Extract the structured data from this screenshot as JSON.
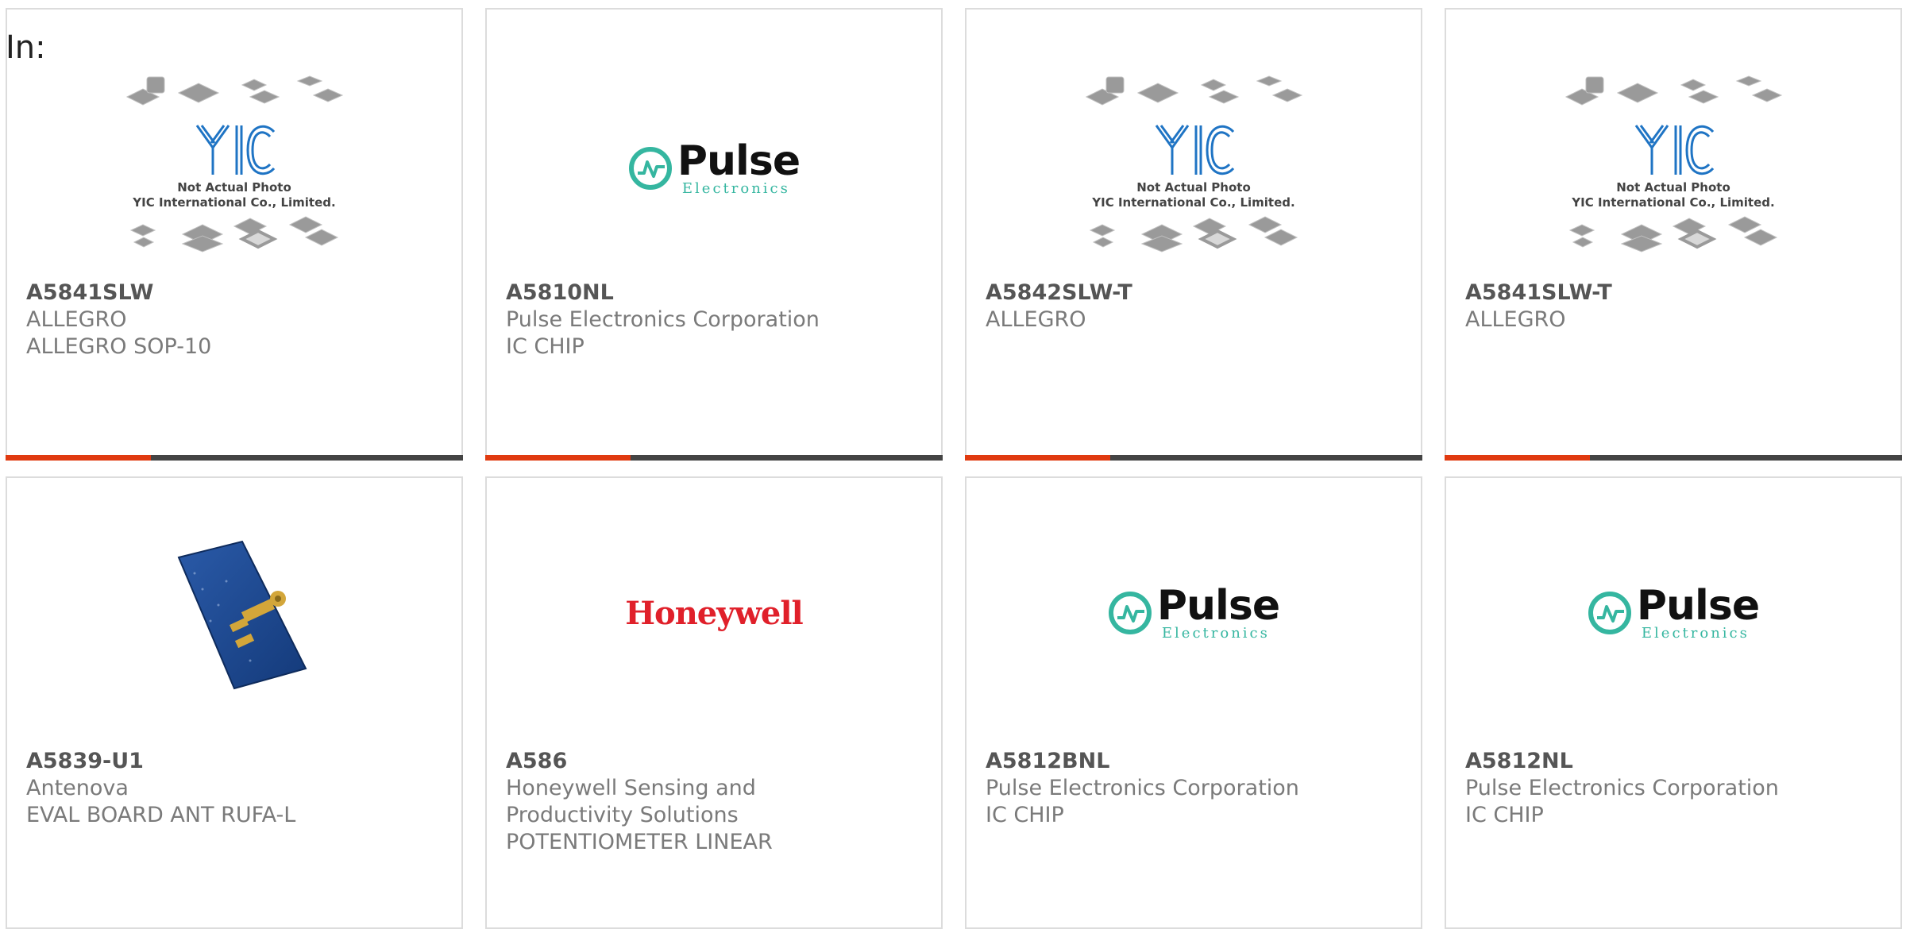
{
  "header": {
    "in_label": "In:"
  },
  "logo_text": {
    "yic_caption_line1": "Not Actual Photo",
    "yic_caption_line2": "YIC International Co., Limited.",
    "pulse_word": "Pulse",
    "pulse_sub": "Electronics",
    "honeywell": "Honeywell"
  },
  "products": [
    {
      "part": "A5841SLW",
      "manufacturer": "ALLEGRO",
      "description": "ALLEGRO SOP-10",
      "image": "yic-placeholder"
    },
    {
      "part": "A5810NL",
      "manufacturer": "Pulse Electronics Corporation",
      "description": "IC CHIP",
      "image": "pulse-logo"
    },
    {
      "part": "A5842SLW-T",
      "manufacturer": "ALLEGRO",
      "description": "",
      "image": "yic-placeholder"
    },
    {
      "part": "A5841SLW-T",
      "manufacturer": "ALLEGRO",
      "description": "",
      "image": "yic-placeholder"
    },
    {
      "part": "A5839-U1",
      "manufacturer": "Antenova",
      "description": "EVAL BOARD ANT RUFA-L",
      "image": "antenna-board-photo"
    },
    {
      "part": "A586",
      "manufacturer": "Honeywell Sensing and Productivity Solutions",
      "description": "POTENTIOMETER LINEAR",
      "image": "honeywell-logo"
    },
    {
      "part": "A5812BNL",
      "manufacturer": "Pulse Electronics Corporation",
      "description": "IC CHIP",
      "image": "pulse-logo"
    },
    {
      "part": "A5812NL",
      "manufacturer": "Pulse Electronics Corporation",
      "description": "IC CHIP",
      "image": "pulse-logo"
    }
  ],
  "colors": {
    "accent": "#e03a10",
    "bar": "#444444",
    "pulse_teal": "#35b6a0",
    "honeywell_red": "#e0202a",
    "yic_blue": "#1f74c4"
  }
}
